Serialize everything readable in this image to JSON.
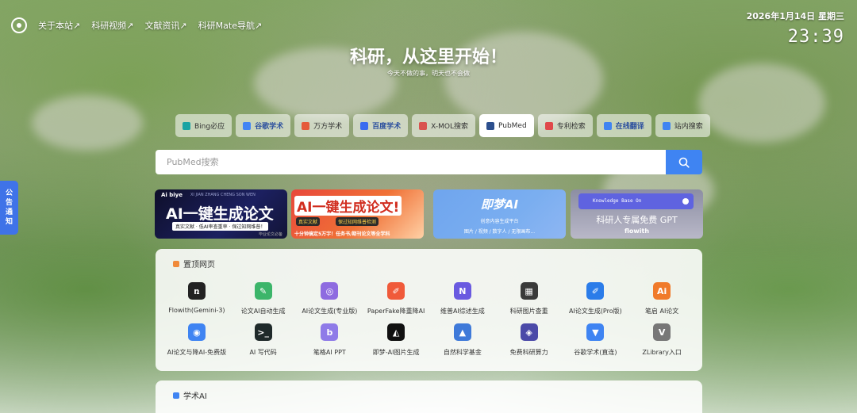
{
  "nav": {
    "links": [
      "关于本站↗",
      "科研视频↗",
      "文献资讯↗",
      "科研Mate导航↗"
    ]
  },
  "clock": {
    "date": "2026年1月14日 星期三",
    "time": "23:39"
  },
  "hero": {
    "title": "科研，从这里开始！",
    "subtitle": "今天不做的事，明天也不会做"
  },
  "engines": [
    {
      "label": "Bing必应",
      "color": "#1aa3a3"
    },
    {
      "label": "谷歌学术",
      "color": "#4285f4"
    },
    {
      "label": "万方学术",
      "color": "#e55a3a"
    },
    {
      "label": "百度学术",
      "color": "#3b6cf0"
    },
    {
      "label": "X-MOL搜索",
      "color": "#d9534f"
    },
    {
      "label": "PubMed",
      "color": "#2c4f8e"
    },
    {
      "label": "专利检索",
      "color": "#e0484a"
    },
    {
      "label": "在线翻译",
      "color": "#3f84f2"
    },
    {
      "label": "站内搜索",
      "color": "#3f84f2"
    }
  ],
  "search": {
    "placeholder": "PubMed搜索"
  },
  "notice": {
    "label": [
      "公",
      "告",
      "通",
      "知"
    ]
  },
  "banners": {
    "b1": {
      "brand": "Ai biye",
      "tiny": "XI JIAN ZHANG CHENG SON WEN",
      "main": "AI一键生成论文",
      "sub": "真实文献 · 低AI率查重率 · 保过知网维普！",
      "foot": "毕业论文必备"
    },
    "b2": {
      "main": "AI一键生成论文!",
      "tag1": "真实文献",
      "tag2": "保过知网维普检测",
      "foot": "十分钟搞定5万字！任务书/期刊论文等全学科"
    },
    "b3": {
      "main": "即梦AI",
      "l1": "创意内容生成平台",
      "l2": "图片 / 视频 / 数字人 / 无限画布..."
    },
    "b4": {
      "kb": "Knowledge Base On",
      "main": "科研人专属免费 GPT",
      "foot": "flowith"
    }
  },
  "pinned": {
    "title": "置顶网页",
    "sites": [
      {
        "name": "Flowith(Gemini-3)",
        "glyph": "ռ",
        "color": "#222222"
      },
      {
        "name": "论文AI自动生成",
        "glyph": "✎",
        "color": "#3cb56a"
      },
      {
        "name": "AI论文生成(专业版)",
        "glyph": "◎",
        "color": "#8e6be0"
      },
      {
        "name": "PaperFake降重降AI",
        "glyph": "✐",
        "color": "#f05a3a"
      },
      {
        "name": "维普AI综述生成",
        "glyph": "N",
        "color": "#6a5ae0"
      },
      {
        "name": "科研图片查重",
        "glyph": "▦",
        "color": "#3a3a3a"
      },
      {
        "name": "AI论文生成(Pro版)",
        "glyph": "✐",
        "color": "#2b7ce9"
      },
      {
        "name": "笔启 AI论文",
        "glyph": "Ai",
        "color": "#f07a2a"
      },
      {
        "name": "AI论文与降AI-免费版",
        "glyph": "◉",
        "color": "#3f84f2"
      },
      {
        "name": "AI 写代码",
        "glyph": ">_",
        "color": "#1f2a2a"
      },
      {
        "name": "笔格AI PPT",
        "glyph": "b",
        "color": "#8f7be8"
      },
      {
        "name": "即梦-AI图片生成",
        "glyph": "◭",
        "color": "#111111"
      },
      {
        "name": "自然科学基金",
        "glyph": "▲",
        "color": "#3f7ad9"
      },
      {
        "name": "免费科研算力",
        "glyph": "◈",
        "color": "#4b4aa8"
      },
      {
        "name": "谷歌学术(直连)",
        "glyph": "▼",
        "color": "#3f84f2"
      },
      {
        "name": "ZLibrary入口",
        "glyph": "V",
        "color": "#777777"
      }
    ]
  },
  "academic": {
    "title": "学术AI"
  }
}
